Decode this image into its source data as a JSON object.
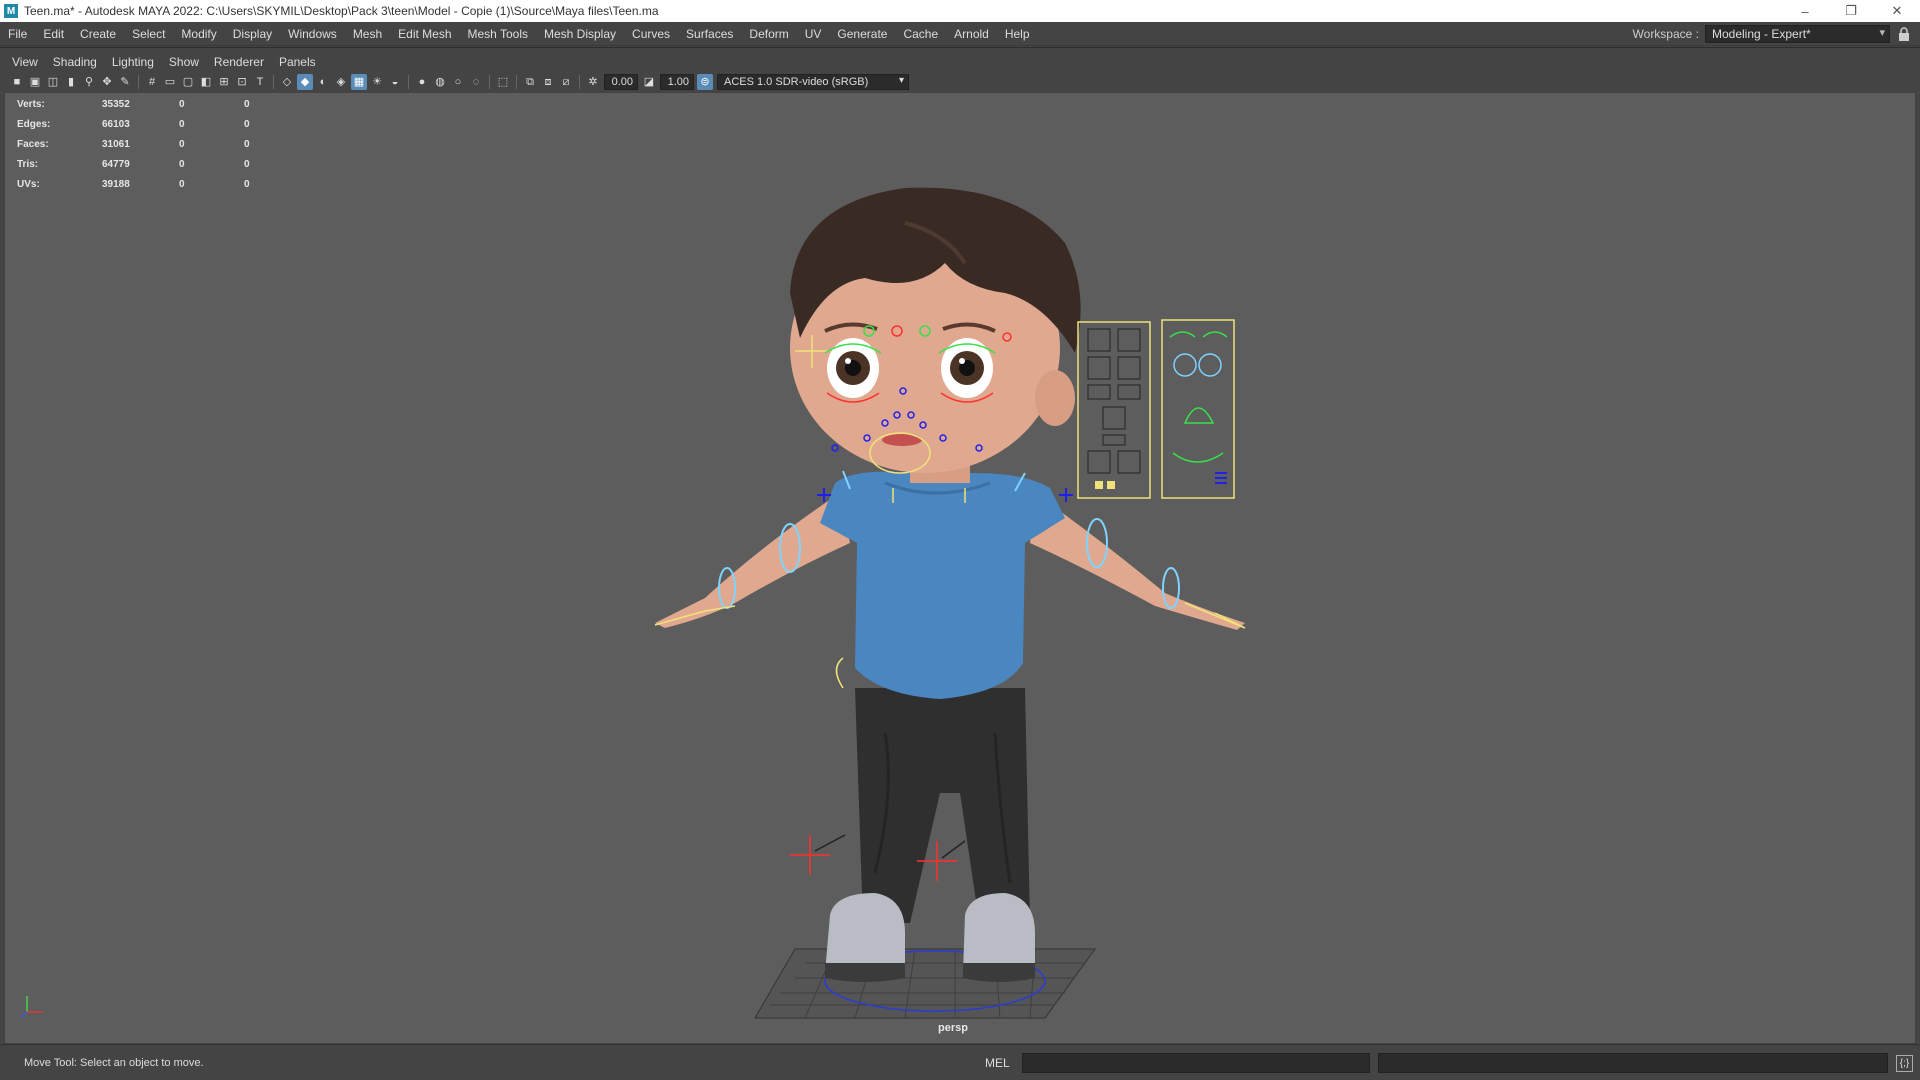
{
  "window": {
    "title": "Teen.ma* - Autodesk MAYA 2022: C:\\Users\\SKYMIL\\Desktop\\Pack 3\\teen\\Model - Copie (1)\\Source\\Maya files\\Teen.ma",
    "app_icon": "M",
    "controls": {
      "minimize": "–",
      "restore": "❐",
      "close": "✕"
    }
  },
  "menubar": {
    "items": [
      "File",
      "Edit",
      "Create",
      "Select",
      "Modify",
      "Display",
      "Windows",
      "Mesh",
      "Edit Mesh",
      "Mesh Tools",
      "Mesh Display",
      "Curves",
      "Surfaces",
      "Deform",
      "UV",
      "Generate",
      "Cache",
      "Arnold",
      "Help"
    ]
  },
  "workspace": {
    "label": "Workspace :",
    "value": "Modeling - Expert*",
    "caret": "▾",
    "lock_icon": "🔒"
  },
  "panel_menu": {
    "items": [
      "View",
      "Shading",
      "Lighting",
      "Show",
      "Renderer",
      "Panels"
    ]
  },
  "viewport_toolbar": {
    "exposure_value": "0.00",
    "gamma_value": "1.00",
    "color_space": "ACES 1.0 SDR-video (sRGB)",
    "caret": "▾"
  },
  "hud": {
    "rows": [
      {
        "label": "Verts:",
        "v1": "35352",
        "v2": "0",
        "v3": "0"
      },
      {
        "label": "Edges:",
        "v1": "66103",
        "v2": "0",
        "v3": "0"
      },
      {
        "label": "Faces:",
        "v1": "31061",
        "v2": "0",
        "v3": "0"
      },
      {
        "label": "Tris:",
        "v1": "64779",
        "v2": "0",
        "v3": "0"
      },
      {
        "label": "UVs:",
        "v1": "39188",
        "v2": "0",
        "v3": "0"
      }
    ]
  },
  "viewport": {
    "camera_label": "persp",
    "background_color": "#5d5d5d"
  },
  "statusbar": {
    "help_line": "Move Tool: Select an object to move.",
    "mel_label": "MEL",
    "script_editor_icon": "{;}"
  },
  "colors": {
    "shirt": "#4a86bf",
    "skin": "#e0a98f",
    "hair": "#3a2a24",
    "pants": "#2f2f2f",
    "controls_cyan": "#7fd3ff",
    "controls_yellow": "#f0e27a",
    "controls_green": "#39e04a",
    "controls_red": "#ff3030",
    "controls_blue": "#2020ee"
  }
}
